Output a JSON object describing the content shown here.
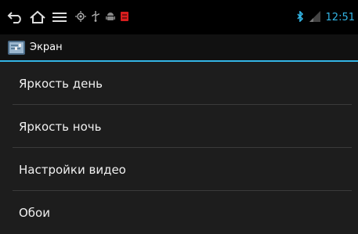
{
  "status_bar": {
    "nav_icons": [
      "back-icon",
      "home-icon",
      "menu-icon"
    ],
    "notification_icons": [
      "gps-icon",
      "usb-icon",
      "android-debug-icon",
      "red-app-icon"
    ],
    "bluetooth_icon": "bluetooth-icon",
    "signal_icon": "signal-icon",
    "time": "12:51",
    "accent_color": "#33b5e5"
  },
  "action_bar": {
    "title": "Экран",
    "icon": "display-settings-icon"
  },
  "settings_items": [
    {
      "label": "Яркость день"
    },
    {
      "label": "Яркость ночь"
    },
    {
      "label": "Настройки видео"
    },
    {
      "label": "Обои"
    }
  ]
}
